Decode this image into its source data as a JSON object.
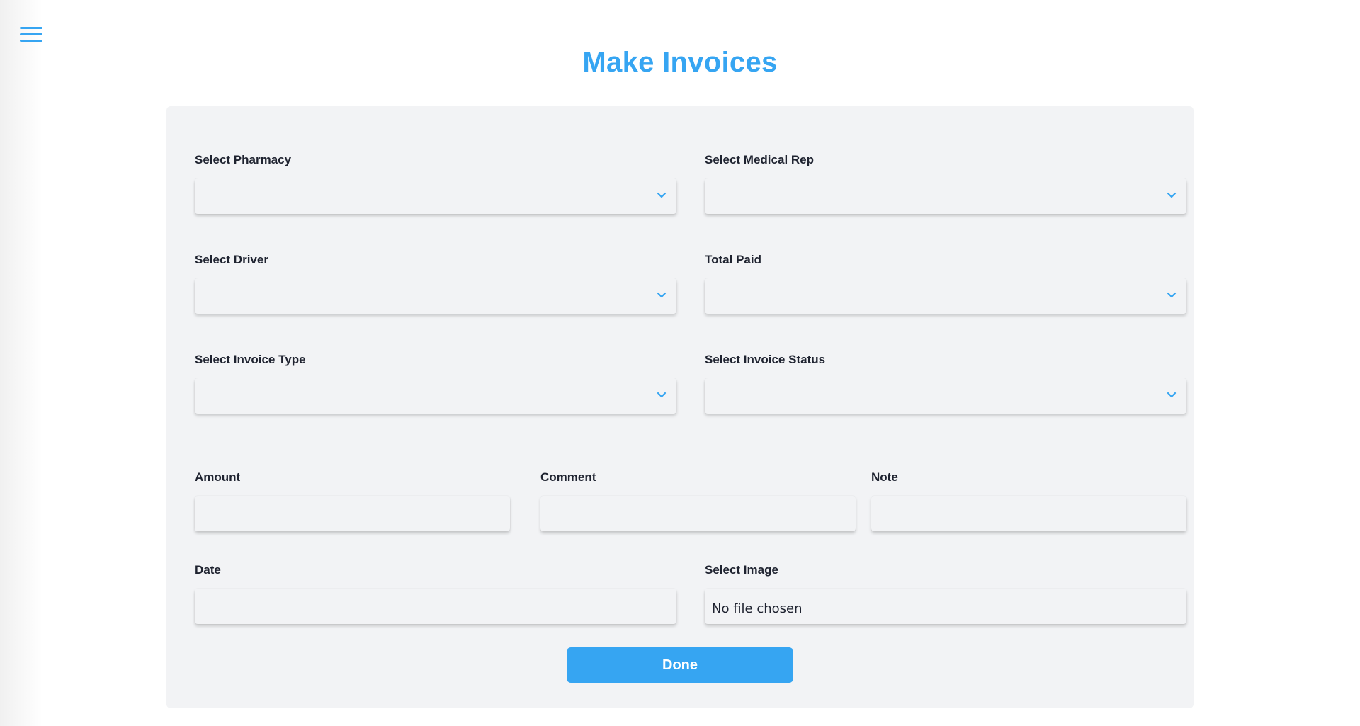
{
  "header": {
    "menu_icon": "hamburger-menu-icon",
    "title": "Make Invoices"
  },
  "form": {
    "pharmacy": {
      "label": "Select Pharmacy",
      "value": ""
    },
    "medical_rep": {
      "label": "Select Medical Rep",
      "value": ""
    },
    "driver": {
      "label": "Select Driver",
      "value": ""
    },
    "total_paid": {
      "label": "Total Paid",
      "value": ""
    },
    "invoice_type": {
      "label": "Select Invoice Type",
      "value": ""
    },
    "invoice_status": {
      "label": "Select Invoice Status",
      "value": ""
    },
    "amount": {
      "label": "Amount",
      "value": ""
    },
    "comment": {
      "label": "Comment",
      "value": ""
    },
    "note": {
      "label": "Note",
      "value": ""
    },
    "date": {
      "label": "Date",
      "value": ""
    },
    "image": {
      "label": "Select Image",
      "status": "No file chosen"
    },
    "done_label": "Done"
  },
  "colors": {
    "accent": "#36a5f2",
    "card_bg": "#f2f3f5",
    "label": "#1f2330"
  }
}
